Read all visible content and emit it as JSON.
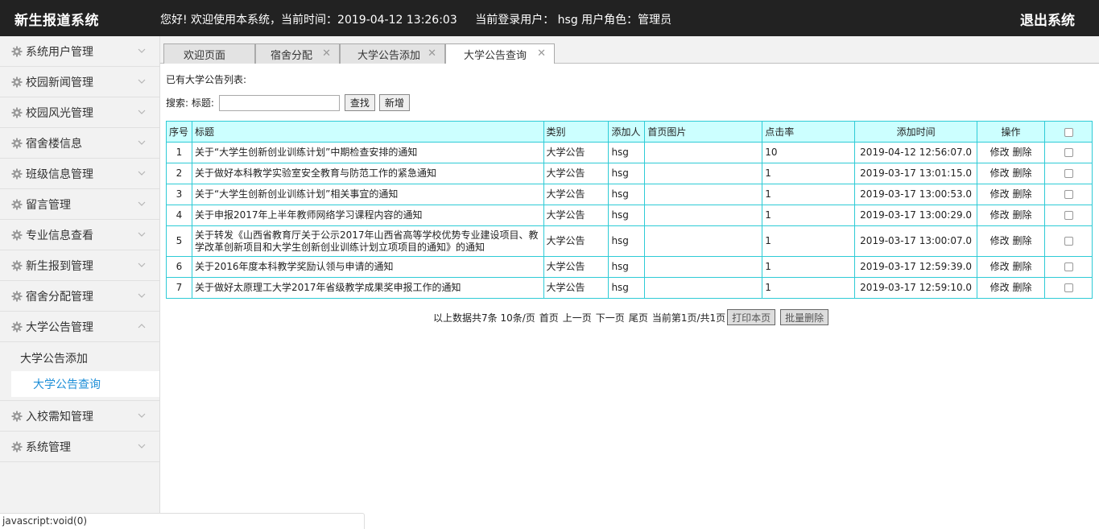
{
  "header": {
    "brand": "新生报道系统",
    "greeting": "您好!  欢迎使用本系统，当前时间：2019-04-12 13:26:03",
    "user": "当前登录用户：  hsg  用户角色：管理员",
    "logout": "退出系统"
  },
  "sidebar": {
    "items_top": [
      {
        "label": "系统用户管理"
      },
      {
        "label": "校园新闻管理"
      },
      {
        "label": "校园风光管理"
      },
      {
        "label": "宿舍楼信息"
      },
      {
        "label": "班级信息管理"
      },
      {
        "label": "留言管理"
      },
      {
        "label": "专业信息查看"
      },
      {
        "label": "新生报到管理"
      },
      {
        "label": "宿舍分配管理"
      },
      {
        "label": "大学公告管理"
      }
    ],
    "submenu": [
      {
        "label": "大学公告添加"
      },
      {
        "label": "大学公告查询"
      }
    ],
    "items_bottom": [
      {
        "label": "入校需知管理"
      },
      {
        "label": "系统管理"
      }
    ]
  },
  "tabs": [
    {
      "label": "欢迎页面"
    },
    {
      "label": "宿舍分配"
    },
    {
      "label": "大学公告添加"
    },
    {
      "label": "大学公告查询"
    }
  ],
  "content": {
    "list_title": "已有大学公告列表:",
    "search_label": "搜索: 标题:",
    "search_value": "",
    "search_button": "查找",
    "add_button": "新增",
    "columns": [
      "序号",
      "标题",
      "类别",
      "添加人",
      "首页图片",
      "点击率",
      "添加时间",
      "操作"
    ],
    "rows": [
      {
        "no": "1",
        "title": "关于“大学生创新创业训练计划”中期检查安排的通知",
        "category": "大学公告",
        "adder": "hsg",
        "image": "",
        "clicks": "10",
        "time": "2019-04-12 12:56:07.0",
        "edit": "修改",
        "del": "删除"
      },
      {
        "no": "2",
        "title": "关于做好本科教学实验室安全教育与防范工作的紧急通知",
        "category": "大学公告",
        "adder": "hsg",
        "image": "",
        "clicks": "1",
        "time": "2019-03-17 13:01:15.0",
        "edit": "修改",
        "del": "删除"
      },
      {
        "no": "3",
        "title": "关于“大学生创新创业训练计划”相关事宜的通知",
        "category": "大学公告",
        "adder": "hsg",
        "image": "",
        "clicks": "1",
        "time": "2019-03-17 13:00:53.0",
        "edit": "修改",
        "del": "删除"
      },
      {
        "no": "4",
        "title": "关于申报2017年上半年教师网络学习课程内容的通知",
        "category": "大学公告",
        "adder": "hsg",
        "image": "",
        "clicks": "1",
        "time": "2019-03-17 13:00:29.0",
        "edit": "修改",
        "del": "删除"
      },
      {
        "no": "5",
        "title": "关于转发《山西省教育厅关于公示2017年山西省高等学校优势专业建设项目、教学改革创新项目和大学生创新创业训练计划立项项目的通知》的通知",
        "category": "大学公告",
        "adder": "hsg",
        "image": "",
        "clicks": "1",
        "time": "2019-03-17 13:00:07.0",
        "edit": "修改",
        "del": "删除"
      },
      {
        "no": "6",
        "title": "关于2016年度本科教学奖励认领与申请的通知",
        "category": "大学公告",
        "adder": "hsg",
        "image": "",
        "clicks": "1",
        "time": "2019-03-17 12:59:39.0",
        "edit": "修改",
        "del": "删除"
      },
      {
        "no": "7",
        "title": "关于做好太原理工大学2017年省级教学成果奖申报工作的通知",
        "category": "大学公告",
        "adder": "hsg",
        "image": "",
        "clicks": "1",
        "time": "2019-03-17 12:59:10.0",
        "edit": "修改",
        "del": "删除"
      }
    ],
    "pager": {
      "summary": "以上数据共7条  10条/页",
      "first": "首页",
      "prev": "上一页",
      "next": "下一页",
      "last": "尾页",
      "current": "当前第1页/共1页",
      "print": "打印本页",
      "batch_delete": "批量删除"
    }
  },
  "statusbar": {
    "text": "javascript:void(0)"
  }
}
